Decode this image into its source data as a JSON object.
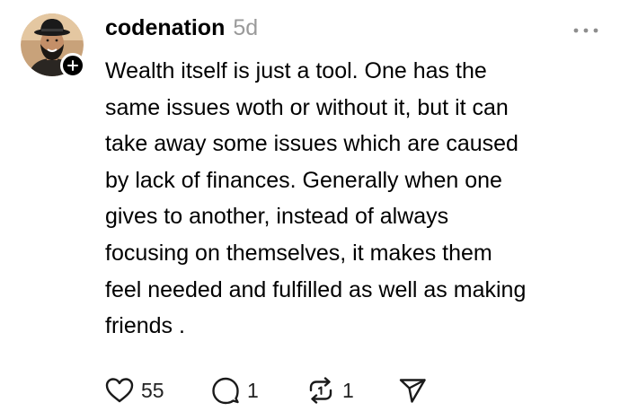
{
  "post": {
    "username": "codenation",
    "time_ago": "5d",
    "body_lines": [
      "Wealth itself is just a tool. One has the",
      "same issues woth or without it, but it can",
      "take away some issues which are caused",
      "by lack of finances. Generally when one",
      "gives to another, instead of always",
      "focusing on themselves, it makes them",
      "feel needed and fulfilled as well as making",
      "friends ."
    ],
    "actions": {
      "likes": "55",
      "replies": "1",
      "reposts": "1"
    }
  },
  "icons": {
    "avatar": "user-avatar-photo",
    "follow": "plus-icon",
    "more": "more-horizontal-icon",
    "like": "heart-icon",
    "reply": "comment-icon",
    "repost": "repost-icon",
    "share": "send-icon"
  },
  "colors": {
    "text": "#000000",
    "muted": "#9a9a9a",
    "background": "#ffffff"
  }
}
